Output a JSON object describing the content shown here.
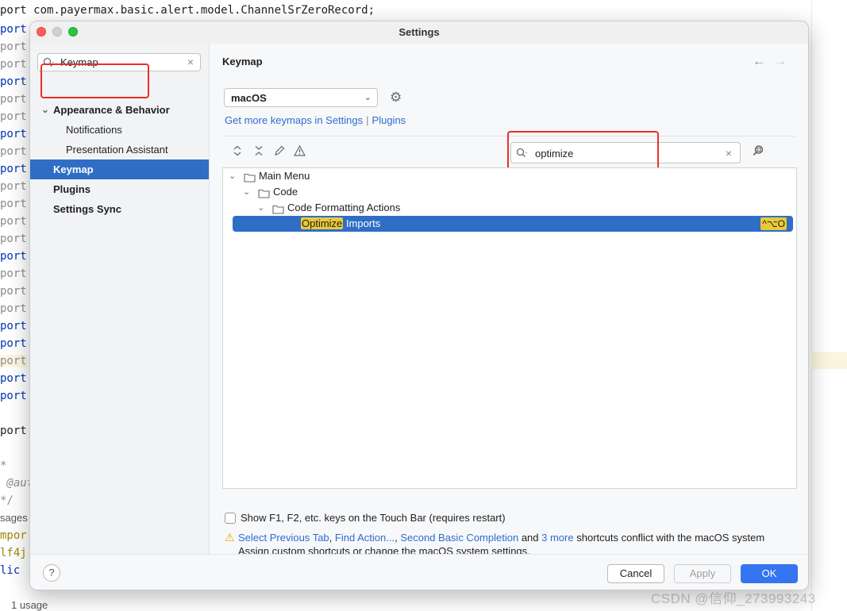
{
  "editor": {
    "top_line": "port com.payermax.basic.alert.model.ChannelSrZeroRecord;",
    "lines": [
      {
        "text": "port",
        "style": "kw"
      },
      {
        "text": "port",
        "style": "grey"
      },
      {
        "text": "port",
        "style": "grey"
      },
      {
        "text": "port",
        "style": "kw"
      },
      {
        "text": "port",
        "style": "grey"
      },
      {
        "text": "port",
        "style": "grey"
      },
      {
        "text": "port",
        "style": "kw"
      },
      {
        "text": "port",
        "style": "grey"
      },
      {
        "text": "port",
        "style": "kw"
      },
      {
        "text": "port",
        "style": "grey"
      },
      {
        "text": "port",
        "style": "grey"
      },
      {
        "text": "port",
        "style": "grey"
      },
      {
        "text": "port",
        "style": "grey"
      },
      {
        "text": "port",
        "style": "kw"
      },
      {
        "text": "port",
        "style": "grey"
      },
      {
        "text": "port",
        "style": "grey"
      },
      {
        "text": "port",
        "style": "grey"
      },
      {
        "text": "port",
        "style": "kw"
      },
      {
        "text": "port",
        "style": "kw"
      },
      {
        "text": "port",
        "style": "grey"
      },
      {
        "text": "port",
        "style": "kw"
      },
      {
        "text": "port",
        "style": "kw"
      }
    ],
    "line_import_last": "port",
    "comment_start": "*",
    "comment_author": " @aut",
    "comment_end": "*/",
    "usages": "sages",
    "component": "mpor",
    "slf4j": "lf4j",
    "public": "lic",
    "usage_hint": "1 usage",
    "watermark": "CSDN @信仰_273993243"
  },
  "dialog": {
    "title": "Settings",
    "sidebar": {
      "search_value": "Keymap",
      "clear_icon": "×",
      "items": [
        {
          "label": "Appearance & Behavior",
          "chevron": "⌄"
        },
        {
          "label": "Notifications"
        },
        {
          "label": "Presentation Assistant"
        },
        {
          "label": "Keymap"
        },
        {
          "label": "Plugins"
        },
        {
          "label": "Settings Sync"
        }
      ]
    },
    "main": {
      "title": "Keymap",
      "back_icon": "←",
      "forward_icon": "→",
      "keymap_select": "macOS",
      "select_arrow": "⌄",
      "gear_icon": "⚙",
      "link_keymaps": "Get more keymaps in Settings",
      "link_sep": "|",
      "link_plugins": "Plugins",
      "toolbar": {
        "expand_icon": "⌃",
        "collapse_icon": "✕",
        "edit_icon": "✎",
        "warning_icon": "⚠"
      },
      "search_value": "optimize",
      "search_clear": "×",
      "find_shortcut_icon": "⌕",
      "tree": [
        {
          "label": "Main Menu",
          "chevron": "⌄"
        },
        {
          "label": "Code",
          "chevron": "⌄"
        },
        {
          "label": "Code Formatting Actions",
          "chevron": "⌄"
        }
      ],
      "selected_action": {
        "match": "Optimize",
        "rest": " Imports",
        "shortcut": "^⌥O"
      },
      "touchbar_checkbox": "Show F1, F2, etc. keys on the Touch Bar (requires restart)",
      "warning": {
        "icon": "⚠",
        "link1": "Select Previous Tab",
        "sep1": ",",
        "link2": "Find Action...",
        "sep2": ",",
        "link3": "Second Basic Completion",
        "and": "and",
        "link4": "3 more",
        "tail": "shortcuts conflict with the macOS system",
        "line2": "Assign custom shortcuts or change the macOS system settings."
      }
    },
    "footer": {
      "help": "?",
      "cancel": "Cancel",
      "apply": "Apply",
      "ok": "OK"
    }
  }
}
